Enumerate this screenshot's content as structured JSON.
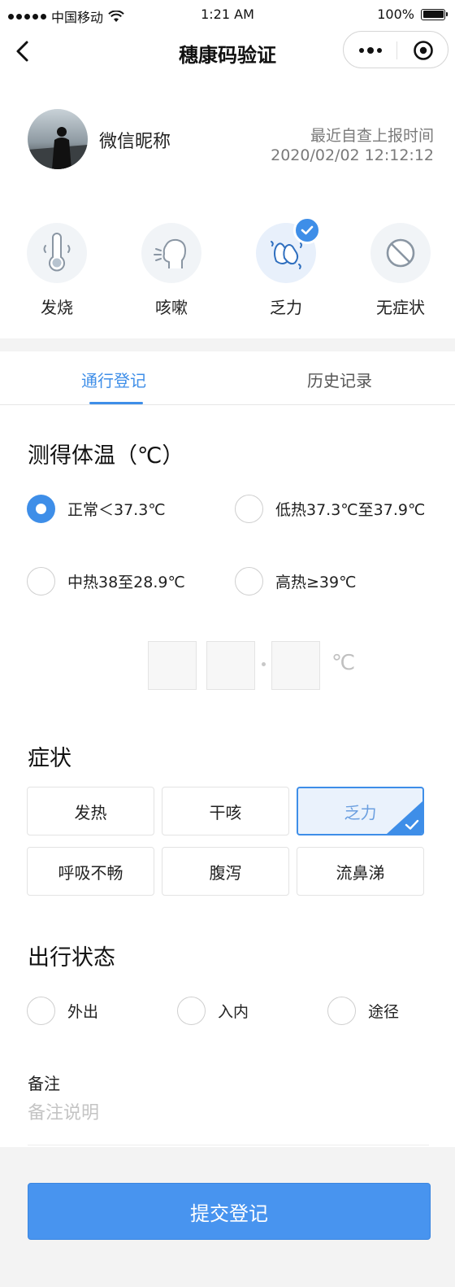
{
  "status_bar": {
    "carrier": "中国移动",
    "time": "1:21 AM",
    "battery": "100%",
    "battery_level": 1.0
  },
  "nav": {
    "title": "穗康码验证"
  },
  "user": {
    "nickname": "微信昵称",
    "report_label": "最近自查上报时间",
    "report_time": "2020/02/02 12:12:12"
  },
  "symptoms_quick": [
    {
      "label": "发烧",
      "icon": "thermometer-icon",
      "selected": false
    },
    {
      "label": "咳嗽",
      "icon": "cough-icon",
      "selected": false
    },
    {
      "label": "乏力",
      "icon": "weak-hands-icon",
      "selected": true
    },
    {
      "label": "无症状",
      "icon": "no-symptom-icon",
      "selected": false
    }
  ],
  "tabs": [
    {
      "label": "通行登记",
      "active": true
    },
    {
      "label": "历史记录",
      "active": false
    }
  ],
  "temperature": {
    "title": "测得体温（℃）",
    "options": [
      {
        "label": "正常＜37.3℃",
        "checked": true
      },
      {
        "label": "低热37.3℃至37.9℃",
        "checked": false
      },
      {
        "label": "中热38至28.9℃",
        "checked": false
      },
      {
        "label": "高热≥39℃",
        "checked": false
      }
    ],
    "unit": "℃"
  },
  "symptoms": {
    "title": "症状",
    "chips": [
      {
        "label": "发热",
        "selected": false
      },
      {
        "label": "干咳",
        "selected": false
      },
      {
        "label": "乏力",
        "selected": true
      },
      {
        "label": "呼吸不畅",
        "selected": false
      },
      {
        "label": "腹泻",
        "selected": false
      },
      {
        "label": "流鼻涕",
        "selected": false
      }
    ]
  },
  "travel": {
    "title": "出行状态",
    "options": [
      {
        "label": "外出",
        "checked": false
      },
      {
        "label": "入内",
        "checked": false
      },
      {
        "label": "途径",
        "checked": false
      }
    ]
  },
  "remark": {
    "label": "备注",
    "placeholder": "备注说明"
  },
  "submit": {
    "label": "提交登记"
  },
  "colors": {
    "accent": "#3e8ee8",
    "button": "#4894ef",
    "muted": "#7a7a7a"
  }
}
